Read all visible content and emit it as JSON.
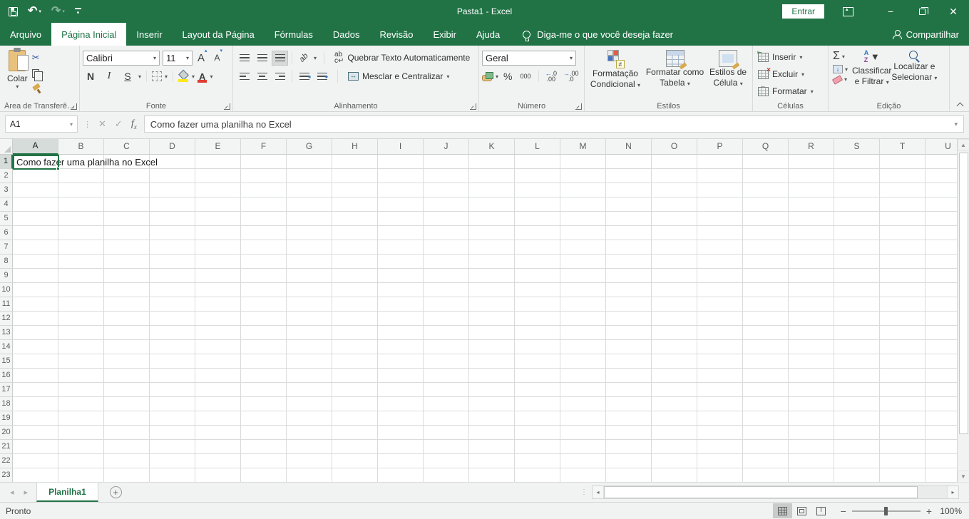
{
  "titlebar": {
    "title": "Pasta1 - Excel",
    "signin_label": "Entrar"
  },
  "tabs": [
    {
      "label": "Arquivo",
      "active": false
    },
    {
      "label": "Página Inicial",
      "active": true
    },
    {
      "label": "Inserir",
      "active": false
    },
    {
      "label": "Layout da Página",
      "active": false
    },
    {
      "label": "Fórmulas",
      "active": false
    },
    {
      "label": "Dados",
      "active": false
    },
    {
      "label": "Revisão",
      "active": false
    },
    {
      "label": "Exibir",
      "active": false
    },
    {
      "label": "Ajuda",
      "active": false
    }
  ],
  "tellme": {
    "label": "Diga-me o que você deseja fazer"
  },
  "share": {
    "label": "Compartilhar"
  },
  "ribbon": {
    "clipboard": {
      "paste": "Colar",
      "group": "Área de Transferê…"
    },
    "font": {
      "font_name": "Calibri",
      "font_size": "11",
      "bold": "N",
      "italic": "I",
      "underline": "S",
      "group": "Fonte"
    },
    "alignment": {
      "wrap": "Quebrar Texto Automaticamente",
      "merge": "Mesclar e Centralizar",
      "group": "Alinhamento"
    },
    "number": {
      "format": "Geral",
      "percent": "%",
      "comma": "000",
      "inc_decimal": "←.0 .00",
      "dec_decimal": "→.00 .0",
      "group": "Número"
    },
    "styles": {
      "conditional_1": "Formatação",
      "conditional_2": "Condicional",
      "as_table_1": "Formatar como",
      "as_table_2": "Tabela",
      "cell_styles_1": "Estilos de",
      "cell_styles_2": "Célula",
      "group": "Estilos"
    },
    "cells": {
      "insert": "Inserir",
      "delete": "Excluir",
      "format": "Formatar",
      "group": "Células"
    },
    "editing": {
      "sort_1": "Classificar",
      "sort_2": "e Filtrar",
      "find_1": "Localizar e",
      "find_2": "Selecionar",
      "group": "Edição"
    }
  },
  "formula_bar": {
    "name_box": "A1",
    "formula": "Como fazer uma planilha no Excel"
  },
  "grid": {
    "columns": [
      "A",
      "B",
      "C",
      "D",
      "E",
      "F",
      "G",
      "H",
      "I",
      "J",
      "K",
      "L",
      "M",
      "N",
      "O",
      "P",
      "Q",
      "R",
      "S",
      "T",
      "U"
    ],
    "row_count": 23,
    "selected_column": "A",
    "selected_row": 1,
    "active_cell": "A1",
    "a1_text": "Como fazer uma planilha no Excel"
  },
  "sheet_bar": {
    "sheet_name": "Planilha1"
  },
  "status_bar": {
    "status": "Pronto",
    "zoom_level": "100%"
  }
}
